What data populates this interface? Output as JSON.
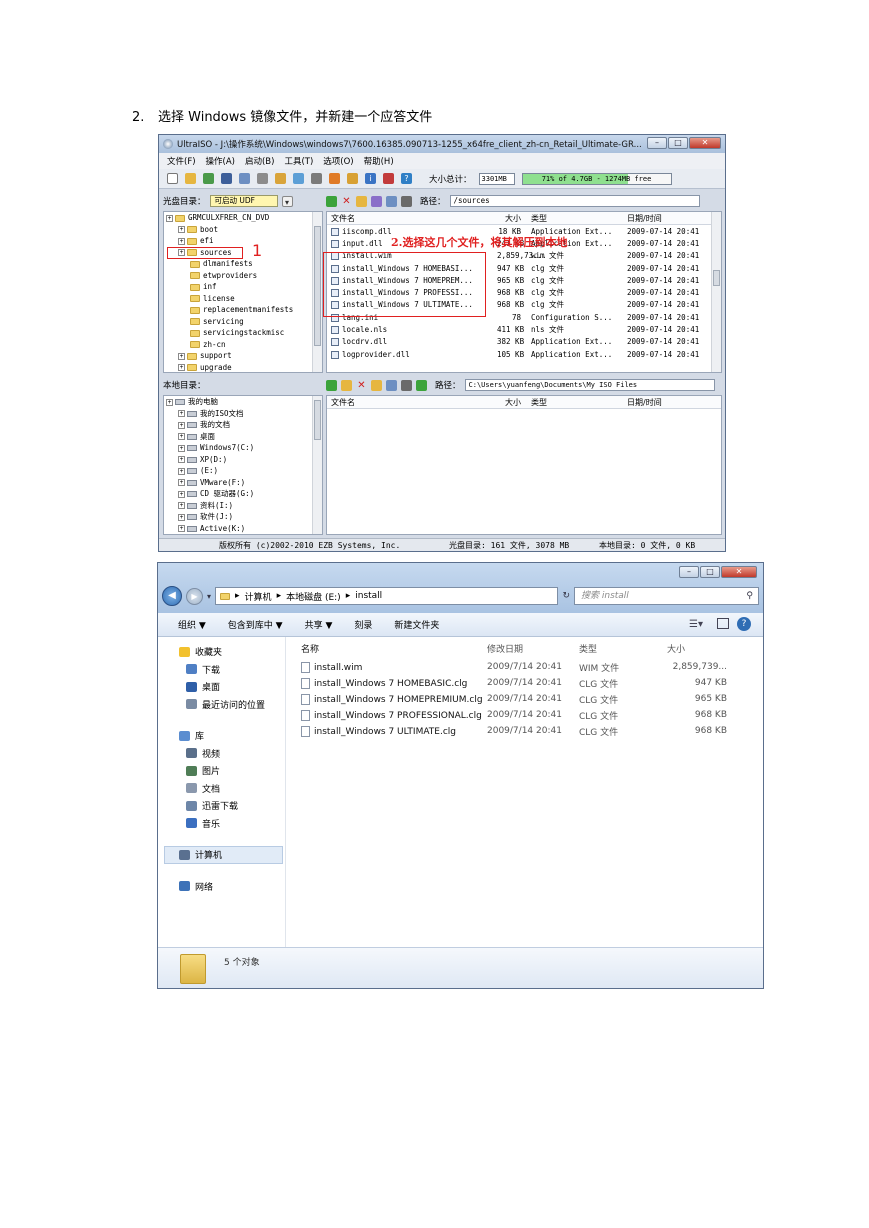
{
  "step": {
    "number": "2.",
    "text": "选择 Windows 镜像文件，并新建一个应答文件"
  },
  "ultraiso": {
    "title": "UltraISO - J:\\操作系统\\Windows\\windows7\\7600.16385.090713-1255_x64fre_client_zh-cn_Retail_Ultimate-GR...",
    "menu": [
      "文件(F)",
      "操作(A)",
      "启动(B)",
      "工具(T)",
      "选项(O)",
      "帮助(H)"
    ],
    "total_label": "大小总计：",
    "total_value": "3301MB",
    "total_bar_text": "71% of 4.7GB - 1274MB free",
    "total_fraction": 0.71,
    "disc_label": "光盘目录：",
    "disc_type": "可启动 UDF",
    "path_label": "路径：",
    "path_top": "/sources",
    "path_bottom": "C:\\Users\\yuanfeng\\Documents\\My ISO Files",
    "local_label": "本地目录：",
    "tree_top": [
      {
        "label": "GRMCULXFRER_CN_DVD",
        "level": 0
      },
      {
        "label": "boot",
        "level": 1
      },
      {
        "label": "efi",
        "level": 1
      },
      {
        "label": "sources",
        "level": 1
      },
      {
        "label": "dlmanifests",
        "level": 2
      },
      {
        "label": "etwproviders",
        "level": 2
      },
      {
        "label": "inf",
        "level": 2
      },
      {
        "label": "license",
        "level": 2
      },
      {
        "label": "replacementmanifests",
        "level": 2
      },
      {
        "label": "servicing",
        "level": 2
      },
      {
        "label": "servicingstackmisc",
        "level": 2
      },
      {
        "label": "zh-cn",
        "level": 2
      },
      {
        "label": "support",
        "level": 1
      },
      {
        "label": "upgrade",
        "level": 1
      }
    ],
    "tree_bottom": [
      {
        "label": "我的电脑",
        "level": 0
      },
      {
        "label": "我的ISO文档",
        "level": 1
      },
      {
        "label": "我的文档",
        "level": 1
      },
      {
        "label": "桌面",
        "level": 1
      },
      {
        "label": "Windows7(C:)",
        "level": 1
      },
      {
        "label": "XP(D:)",
        "level": 1
      },
      {
        "label": "(E:)",
        "level": 1
      },
      {
        "label": "VMware(F:)",
        "level": 1
      },
      {
        "label": "CD 驱动器(G:)",
        "level": 1
      },
      {
        "label": "资料(I:)",
        "level": 1
      },
      {
        "label": "软件(J:)",
        "level": 1
      },
      {
        "label": "Active(K:)",
        "level": 1
      }
    ],
    "columns": {
      "name": "文件名",
      "size": "大小",
      "type": "类型",
      "date": "日期/时间"
    },
    "files": [
      {
        "name": "iiscomp.dll",
        "size": "18 KB",
        "type": "Application Ext...",
        "date": "2009-07-14 20:41"
      },
      {
        "name": "input.dll",
        "size": "241 KB",
        "type": "Application Ext...",
        "date": "2009-07-14 20:41"
      },
      {
        "name": "install.wim",
        "size": "2,859,73...",
        "type": "wim 文件",
        "date": "2009-07-14 20:41"
      },
      {
        "name": "install_Windows 7 HOMEBASI...",
        "size": "947 KB",
        "type": "clg 文件",
        "date": "2009-07-14 20:41"
      },
      {
        "name": "install_Windows 7 HOMEPREM...",
        "size": "965 KB",
        "type": "clg 文件",
        "date": "2009-07-14 20:41"
      },
      {
        "name": "install_Windows 7 PROFESSI...",
        "size": "968 KB",
        "type": "clg 文件",
        "date": "2009-07-14 20:41"
      },
      {
        "name": "install_Windows 7 ULTIMATE...",
        "size": "968 KB",
        "type": "clg 文件",
        "date": "2009-07-14 20:41"
      },
      {
        "name": "lang.ini",
        "size": "78",
        "type": "Configuration S...",
        "date": "2009-07-14 20:41"
      },
      {
        "name": "locale.nls",
        "size": "411 KB",
        "type": "nls 文件",
        "date": "2009-07-14 20:41"
      },
      {
        "name": "locdrv.dll",
        "size": "382 KB",
        "type": "Application Ext...",
        "date": "2009-07-14 20:41"
      },
      {
        "name": "logprovider.dll",
        "size": "105 KB",
        "type": "Application Ext...",
        "date": "2009-07-14 20:41"
      }
    ],
    "status": {
      "copyright": "版权所有 (c)2002-2010 EZB Systems, Inc.",
      "disc": "光盘目录: 161 文件, 3078 MB",
      "local": "本地目录: 0 文件, 0 KB"
    },
    "annotation_1": "1",
    "annotation_2": "2.选择这几个文件，将其解压到本地"
  },
  "explorer": {
    "breadcrumb": [
      "计算机",
      "本地磁盘 (E:)",
      "install"
    ],
    "search_placeholder": "搜索 install",
    "commands": [
      "组织 ▼",
      "包含到库中 ▼",
      "共享 ▼",
      "刻录",
      "新建文件夹"
    ],
    "nav": [
      {
        "label": "收藏夹",
        "group": true,
        "color": "#f2c12e"
      },
      {
        "label": "下载",
        "group": false,
        "color": "#4f7fc4"
      },
      {
        "label": "桌面",
        "group": false,
        "color": "#2f5fa8"
      },
      {
        "label": "最近访问的位置",
        "group": false,
        "color": "#7a8ba3"
      },
      {
        "label": "",
        "group": false,
        "color": ""
      },
      {
        "label": "库",
        "group": true,
        "color": "#5b8dd0"
      },
      {
        "label": "视频",
        "group": false,
        "color": "#5a6f8a"
      },
      {
        "label": "图片",
        "group": false,
        "color": "#4f7d56"
      },
      {
        "label": "文档",
        "group": false,
        "color": "#8a98ad"
      },
      {
        "label": "迅雷下载",
        "group": false,
        "color": "#6d86a8"
      },
      {
        "label": "音乐",
        "group": false,
        "color": "#3b6fc0"
      },
      {
        "label": "",
        "group": false,
        "color": ""
      },
      {
        "label": "计算机",
        "group": true,
        "color": "#5a7090",
        "selected": true
      },
      {
        "label": "",
        "group": false,
        "color": ""
      },
      {
        "label": "网络",
        "group": true,
        "color": "#3d72b8"
      }
    ],
    "columns": {
      "name": "名称",
      "date": "修改日期",
      "type": "类型",
      "size": "大小"
    },
    "files": [
      {
        "name": "install.wim",
        "date": "2009/7/14 20:41",
        "type": "WIM 文件",
        "size": "2,859,739..."
      },
      {
        "name": "install_Windows 7 HOMEBASIC.clg",
        "date": "2009/7/14 20:41",
        "type": "CLG 文件",
        "size": "947 KB"
      },
      {
        "name": "install_Windows 7 HOMEPREMIUM.clg",
        "date": "2009/7/14 20:41",
        "type": "CLG 文件",
        "size": "965 KB"
      },
      {
        "name": "install_Windows 7 PROFESSIONAL.clg",
        "date": "2009/7/14 20:41",
        "type": "CLG 文件",
        "size": "968 KB"
      },
      {
        "name": "install_Windows 7 ULTIMATE.clg",
        "date": "2009/7/14 20:41",
        "type": "CLG 文件",
        "size": "968 KB"
      }
    ],
    "count": "5 个对象"
  }
}
